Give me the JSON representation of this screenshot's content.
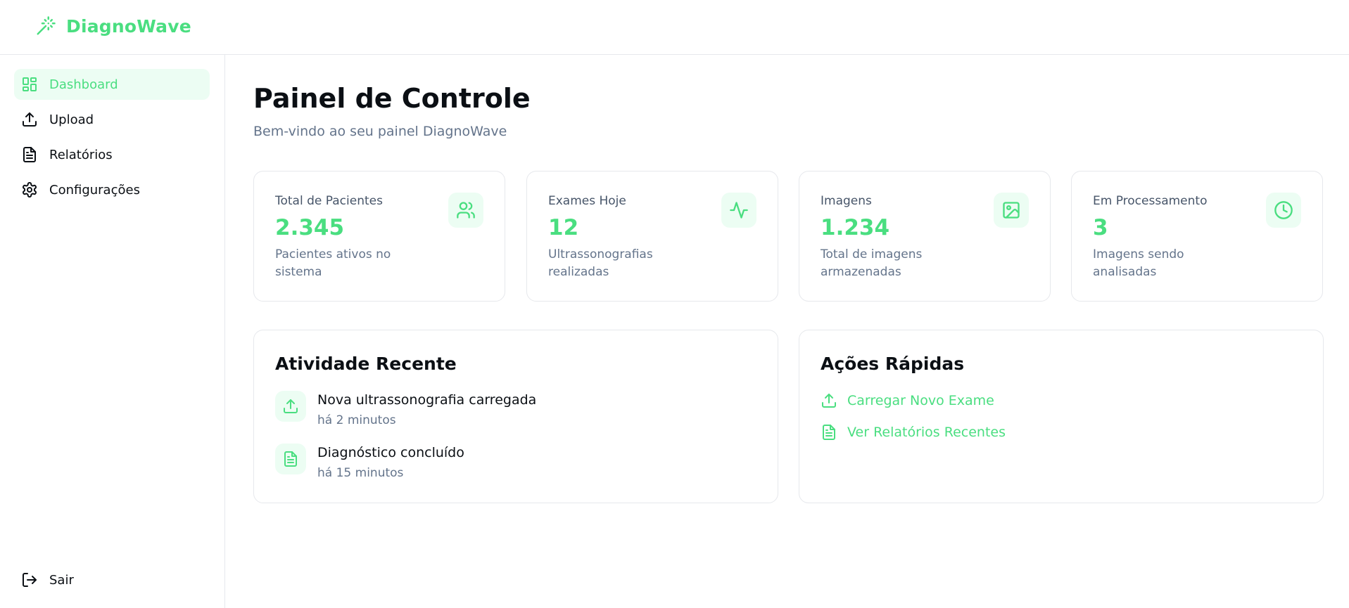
{
  "brand": {
    "name": "DiagnoWave",
    "icon": "magic-wand-icon",
    "color": "#4ade80"
  },
  "sidebar": {
    "items": [
      {
        "label": "Dashboard",
        "icon": "dashboard-grid-icon",
        "active": true
      },
      {
        "label": "Upload",
        "icon": "upload-icon",
        "active": false
      },
      {
        "label": "Relatórios",
        "icon": "document-icon",
        "active": false
      },
      {
        "label": "Configurações",
        "icon": "gear-icon",
        "active": false
      }
    ],
    "logout": {
      "label": "Sair",
      "icon": "logout-icon"
    }
  },
  "main": {
    "title": "Painel de Controle",
    "subtitle": "Bem-vindo ao seu painel DiagnoWave",
    "stats": [
      {
        "label": "Total de Pacientes",
        "value": "2.345",
        "desc": "Pacientes ativos no sistema",
        "icon": "users-icon"
      },
      {
        "label": "Exames Hoje",
        "value": "12",
        "desc": "Ultrassonografias realizadas",
        "icon": "activity-icon"
      },
      {
        "label": "Imagens",
        "value": "1.234",
        "desc": "Total de imagens armazenadas",
        "icon": "image-icon"
      },
      {
        "label": "Em Processamento",
        "value": "3",
        "desc": "Imagens sendo analisadas",
        "icon": "clock-icon"
      }
    ],
    "recent_activity": {
      "title": "Atividade Recente",
      "items": [
        {
          "title": "Nova ultrassonografia carregada",
          "time": "há 2 minutos",
          "icon": "upload-icon"
        },
        {
          "title": "Diagnóstico concluído",
          "time": "há 15 minutos",
          "icon": "document-icon"
        }
      ]
    },
    "quick_actions": {
      "title": "Ações Rápidas",
      "items": [
        {
          "label": "Carregar Novo Exame",
          "icon": "upload-icon"
        },
        {
          "label": "Ver Relatórios Recentes",
          "icon": "document-icon"
        }
      ]
    }
  },
  "colors": {
    "accent": "#4ade80",
    "accent_bg": "#ecfdf3",
    "border": "#e6e8ec",
    "muted_text": "#64748b"
  }
}
